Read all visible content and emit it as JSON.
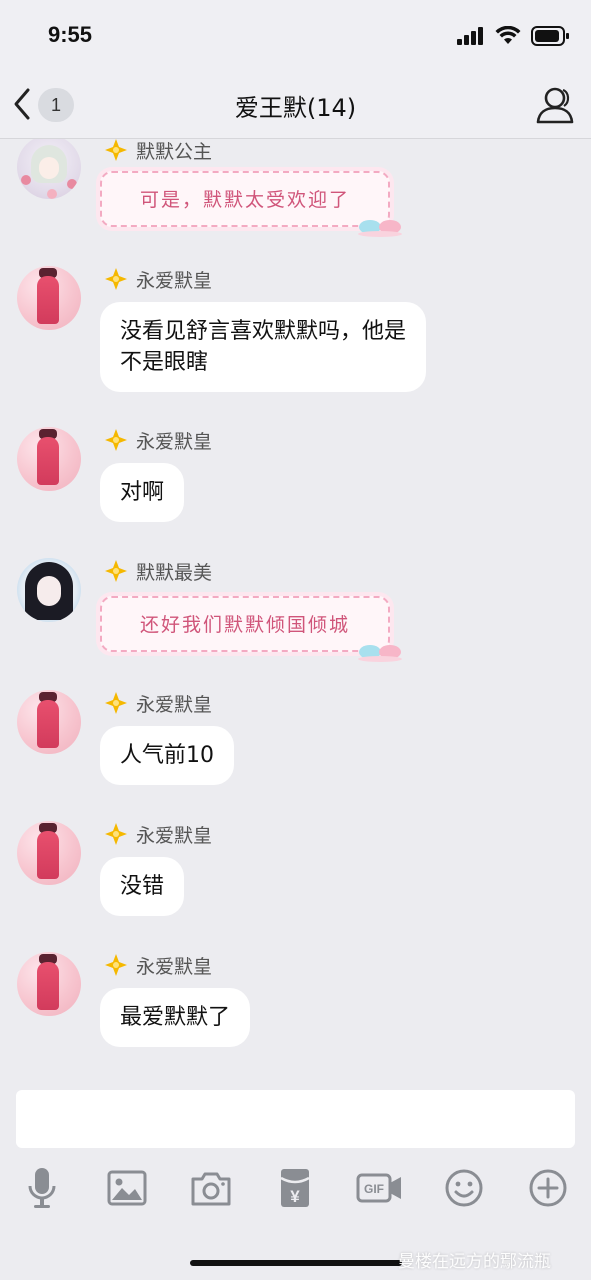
{
  "status_bar": {
    "time": "9:55"
  },
  "header": {
    "unread_count": "1",
    "title": "爱王默(14)"
  },
  "messages": [
    {
      "sender": "默默公主",
      "text": "可是，默默太受欢迎了",
      "style": "fancy"
    },
    {
      "sender": "永爱默皇",
      "line1": "没看见舒言喜欢默默吗，他是",
      "line2": "不是眼瞎"
    },
    {
      "sender": "永爱默皇",
      "text": "对啊"
    },
    {
      "sender": "默默最美",
      "text": "还好我们默默倾国倾城",
      "style": "fancy"
    },
    {
      "sender": "永爱默皇",
      "text": "人气前10"
    },
    {
      "sender": "永爱默皇",
      "text": "没错"
    },
    {
      "sender": "永爱默皇",
      "text": "最爱默默了"
    }
  ],
  "input": {
    "value": ""
  },
  "toolbar": {
    "items": [
      "microphone-icon",
      "image-icon",
      "camera-icon",
      "red-packet-icon",
      "gif-icon",
      "emoji-icon",
      "plus-icon"
    ],
    "gif_label": "GIF",
    "yuan_symbol": "¥"
  },
  "watermark": {
    "text": "曼楼在远方的鄢流瓶"
  },
  "colors": {
    "background": "#ececf0",
    "bubble": "#ffffff",
    "fancy_text": "#d0557a",
    "badge": "#f5b800"
  }
}
